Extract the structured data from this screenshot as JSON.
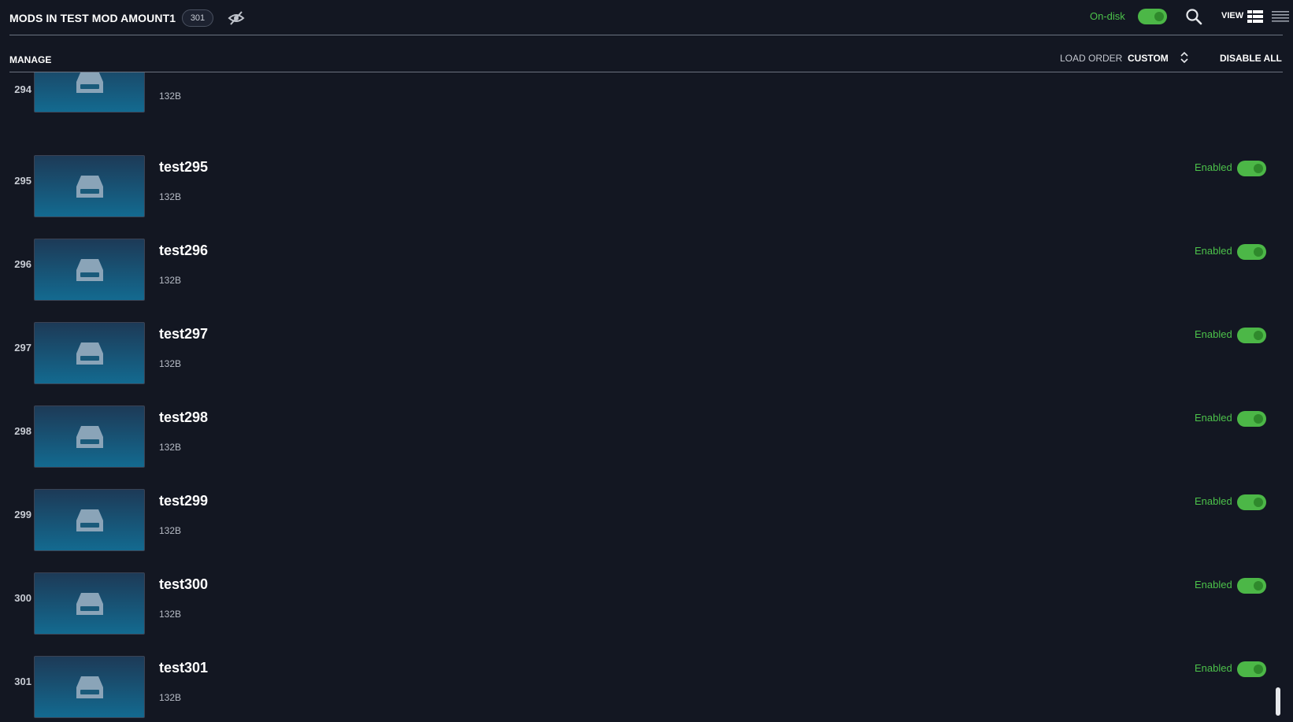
{
  "header": {
    "title": "MODS IN TEST MOD AMOUNT1",
    "count": "301",
    "hide_icon": "eye-off-icon",
    "ondisk_label": "On-disk",
    "ondisk_enabled": true,
    "search_icon": "search-icon",
    "view_label": "VIEW",
    "view_modes": [
      "grid-view-icon",
      "list-view-icon"
    ],
    "accent_color": "#4cb747"
  },
  "subbar": {
    "manage_label": "MANAGE",
    "load_order_label": "LOAD ORDER",
    "load_order_value": "CUSTOM",
    "disable_all_label": "DISABLE ALL"
  },
  "mods": [
    {
      "index": "294",
      "name": "",
      "size": "132B",
      "status": "",
      "enabled": true
    },
    {
      "index": "295",
      "name": "test295",
      "size": "132B",
      "status": "Enabled",
      "enabled": true
    },
    {
      "index": "296",
      "name": "test296",
      "size": "132B",
      "status": "Enabled",
      "enabled": true
    },
    {
      "index": "297",
      "name": "test297",
      "size": "132B",
      "status": "Enabled",
      "enabled": true
    },
    {
      "index": "298",
      "name": "test298",
      "size": "132B",
      "status": "Enabled",
      "enabled": true
    },
    {
      "index": "299",
      "name": "test299",
      "size": "132B",
      "status": "Enabled",
      "enabled": true
    },
    {
      "index": "300",
      "name": "test300",
      "size": "132B",
      "status": "Enabled",
      "enabled": true
    },
    {
      "index": "301",
      "name": "test301",
      "size": "132B",
      "status": "Enabled",
      "enabled": true
    }
  ],
  "thumbnail_icon": "drive-icon"
}
